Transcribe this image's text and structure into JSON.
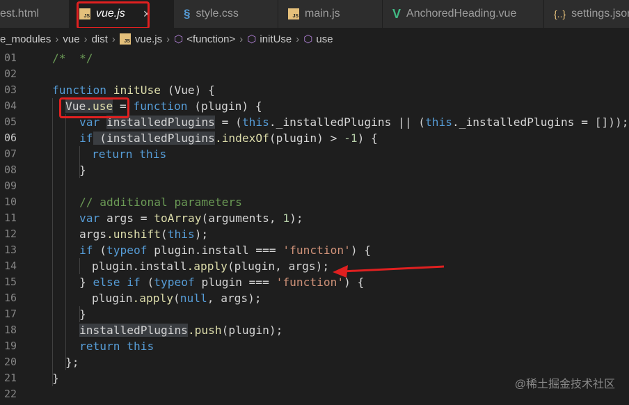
{
  "tabs": [
    {
      "label": "est.html",
      "icon": "html-icon",
      "active": false
    },
    {
      "label": "vue.js",
      "icon": "js-icon",
      "active": true
    },
    {
      "label": "style.css",
      "icon": "css-icon",
      "active": false
    },
    {
      "label": "main.js",
      "icon": "js-icon",
      "active": false
    },
    {
      "label": "AnchoredHeading.vue",
      "icon": "vue-icon",
      "active": false
    },
    {
      "label": "settings.json",
      "icon": "json-icon",
      "active": false
    }
  ],
  "tab_close_glyph": "×",
  "js_badge": "JS",
  "breadcrumb": [
    "e_modules",
    "vue",
    "dist",
    "vue.js",
    "<function>",
    "initUse",
    "use"
  ],
  "line_numbers": [
    "01",
    "02",
    "03",
    "04",
    "05",
    "06",
    "07",
    "08",
    "09",
    "10",
    "11",
    "12",
    "13",
    "14",
    "15",
    "16",
    "17",
    "18",
    "19",
    "20",
    "21",
    "22"
  ],
  "code": {
    "l01": "/*  */",
    "l03_kw": "function",
    "l03_name": "initUse",
    "l03_rest": " (Vue) {",
    "l04_a": "Vue",
    "l04_b": ".use",
    "l04_c": " = ",
    "l04_kw": "function",
    "l04_d": " (plugin) {",
    "l05_kw": "var",
    "l05_a": "installedPlugins",
    "l05_b": " = (",
    "l05_this": "this",
    "l05_c": "._installedPlugins || (",
    "l05_this2": "this",
    "l05_d": "._installedPlugins = []));",
    "l06_kw": "if",
    "l06_a": " (installedPlugins",
    "l06_b": ".indexOf",
    "l06_c": "(plugin) > ",
    "l06_num": "-1",
    "l06_d": ") {",
    "l07_kw": "return",
    "l07_this": "this",
    "l08": "}",
    "l10_cm": "// additional parameters",
    "l11_kw": "var",
    "l11_a": " args = ",
    "l11_fn": "toArray",
    "l11_b": "(arguments, ",
    "l11_num": "1",
    "l11_c": ");",
    "l12_a": "args",
    "l12_fn": ".unshift",
    "l12_b": "(",
    "l12_this": "this",
    "l12_c": ");",
    "l13_kw": "if",
    "l13_a": " (",
    "l13_kw2": "typeof",
    "l13_b": " plugin.install === ",
    "l13_str": "'function'",
    "l13_c": ") {",
    "l14_a": "plugin.install",
    "l14_fn": ".apply",
    "l14_b": "(plugin, args);",
    "l15_a": "} ",
    "l15_kw": "else if",
    "l15_b": " (",
    "l15_kw2": "typeof",
    "l15_c": " plugin === ",
    "l15_str": "'function'",
    "l15_d": ") {",
    "l16_a": "plugin",
    "l16_fn": ".apply",
    "l16_b": "(",
    "l16_null": "null",
    "l16_c": ", args);",
    "l17": "}",
    "l18_a": "installedPlugins",
    "l18_fn": ".push",
    "l18_b": "(plugin);",
    "l19_kw": "return",
    "l19_this": "this",
    "l20": "};",
    "l21": "}"
  },
  "watermark": "@稀土掘金技术社区",
  "colors": {
    "annotation_red": "#e02020",
    "keyword": "#569cd6",
    "function": "#dcdcaa",
    "string": "#ce9178",
    "comment": "#6a9955"
  }
}
